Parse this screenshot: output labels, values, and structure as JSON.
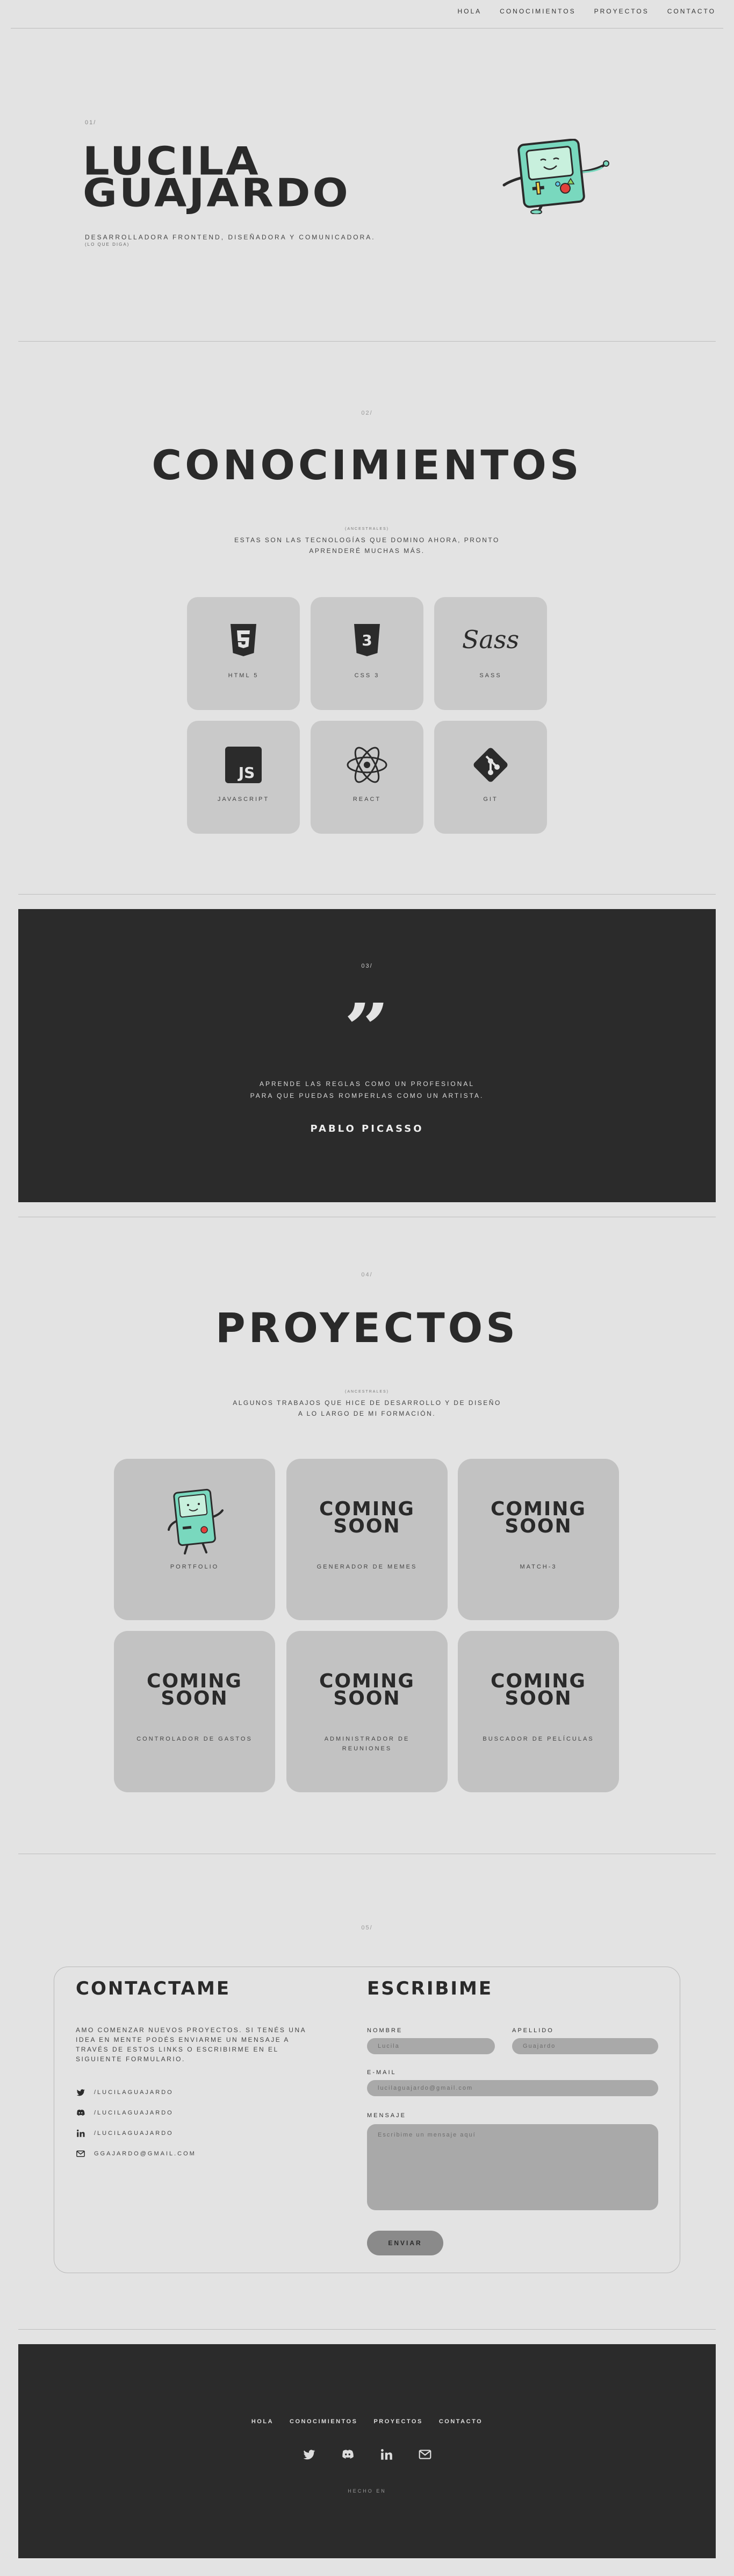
{
  "nav": {
    "items": [
      "HOLA",
      "CONOCIMIENTOS",
      "PROYECTOS",
      "CONTACTO"
    ]
  },
  "hero": {
    "number": "01/",
    "name_line1": "LUCILA",
    "name_line2": "GUAJARDO",
    "subtitle": "DESARROLLADORA FRONTEND, DISEÑADORA Y COMUNICADORA.",
    "small": "(LO QUE DIGA)"
  },
  "skills": {
    "number": "02/",
    "title": "CONOCIMIENTOS",
    "tiny": "(ANCESTRALES)",
    "description": "ESTAS SON LAS TECNOLOGÍAS QUE DOMINO AHORA, PRONTO APRENDERÉ MUCHAS MÁS.",
    "items": [
      {
        "label": "HTML 5",
        "icon": "html5-icon"
      },
      {
        "label": "CSS 3",
        "icon": "css3-icon"
      },
      {
        "label": "SASS",
        "icon": "sass-icon"
      },
      {
        "label": "JAVASCRIPT",
        "icon": "javascript-icon"
      },
      {
        "label": "REACT",
        "icon": "react-icon"
      },
      {
        "label": "GIT",
        "icon": "git-icon"
      }
    ]
  },
  "quote": {
    "number": "03/",
    "mark": "”",
    "line1": "APRENDE LAS REGLAS COMO UN PROFESIONAL",
    "line2": "PARA QUE PUEDAS ROMPERLAS COMO UN ARTISTA.",
    "author": "PABLO PICASSO"
  },
  "projects": {
    "number": "04/",
    "title": "PROYECTOS",
    "tiny": "(ANCESTRALES)",
    "description": "ALGUNOS TRABAJOS QUE HICE DE DESARROLLO Y DE DISEÑO A LO LARGO DE MI FORMACIÓN.",
    "coming_soon_line1": "COMING",
    "coming_soon_line2": "SOON",
    "items": [
      {
        "label": "PORTFOLIO"
      },
      {
        "label": "GENERADOR DE MEMES"
      },
      {
        "label": "MATCH-3"
      },
      {
        "label": "CONTROLADOR DE GASTOS"
      },
      {
        "label": "ADMINISTRADOR DE REUNIONES"
      },
      {
        "label": "BUSCADOR DE PELÍCULAS"
      }
    ]
  },
  "contact": {
    "number": "05/",
    "title_left": "CONTACTAME",
    "intro": "AMO COMENZAR NUEVOS PROYECTOS. SI TENÉS UNA IDEA EN MENTE PODÉS ENVIARME UN MENSAJE A TRAVÉS DE ESTOS LINKS O ESCRIBIRME EN EL SIGUIENTE FORMULARIO.",
    "links": [
      {
        "icon": "twitter-icon",
        "text": "/LUCILAGUAJARDO"
      },
      {
        "icon": "discord-icon",
        "text": "/LUCILAGUAJARDO"
      },
      {
        "icon": "linkedin-icon",
        "text": "/LUCILAGUAJARDO"
      },
      {
        "icon": "mail-icon",
        "text": "GGAJARDO@GMAIL.COM"
      }
    ],
    "title_right": "ESCRIBIME",
    "form": {
      "name_label": "NOMBRE",
      "name_placeholder": "Lucila",
      "surname_label": "APELLIDO",
      "surname_placeholder": "Guajardo",
      "email_label": "E-MAIL",
      "email_placeholder": "lucilaguajardo@gmail.com",
      "message_label": "MENSAJE",
      "message_placeholder": "Escribime un mensaje aquí",
      "submit": "ENVIAR"
    }
  },
  "footer": {
    "nav": [
      "HOLA",
      "CONOCIMIENTOS",
      "PROYECTOS",
      "CONTACTO"
    ],
    "made": "HECHO EN"
  }
}
